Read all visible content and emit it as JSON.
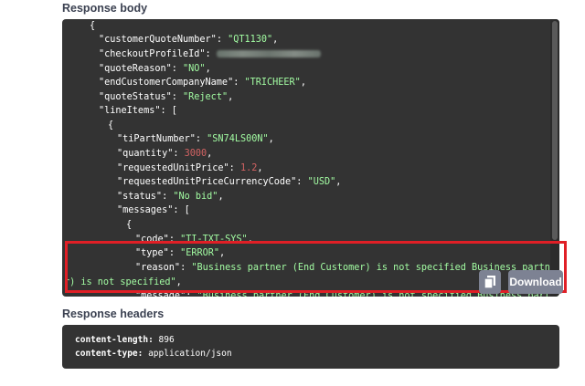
{
  "response_body": {
    "title": "Response body",
    "lines": [
      {
        "t": [
          [
            "p",
            "{"
          ]
        ]
      },
      {
        "t": [
          [
            "k",
            "\"customerQuoteNumber\""
          ],
          [
            "p",
            ": "
          ],
          [
            "s",
            "\"QT1130\""
          ],
          [
            "p",
            ","
          ]
        ]
      },
      {
        "t": [
          [
            "k",
            "\"checkoutProfileId\""
          ],
          [
            "p",
            ": "
          ],
          [
            "blur",
            ""
          ]
        ]
      },
      {
        "t": [
          [
            "k",
            "\"quoteReason\""
          ],
          [
            "p",
            ": "
          ],
          [
            "s",
            "\"NO\""
          ],
          [
            "p",
            ","
          ]
        ]
      },
      {
        "t": [
          [
            "k",
            "\"endCustomerCompanyName\""
          ],
          [
            "p",
            ": "
          ],
          [
            "s",
            "\"TRICHEER\""
          ],
          [
            "p",
            ","
          ]
        ]
      },
      {
        "t": [
          [
            "k",
            "\"quoteStatus\""
          ],
          [
            "p",
            ": "
          ],
          [
            "s",
            "\"Reject\""
          ],
          [
            "p",
            ","
          ]
        ]
      },
      {
        "t": [
          [
            "k",
            "\"lineItems\""
          ],
          [
            "p",
            ": ["
          ]
        ]
      },
      {
        "t": [
          [
            "p",
            "{"
          ]
        ]
      },
      {
        "t": [
          [
            "k",
            "\"tiPartNumber\""
          ],
          [
            "p",
            ": "
          ],
          [
            "s",
            "\"SN74LS00N\""
          ],
          [
            "p",
            ","
          ]
        ]
      },
      {
        "t": [
          [
            "k",
            "\"quantity\""
          ],
          [
            "p",
            ": "
          ],
          [
            "n",
            "3000"
          ],
          [
            "p",
            ","
          ]
        ]
      },
      {
        "t": [
          [
            "k",
            "\"requestedUnitPrice\""
          ],
          [
            "p",
            ": "
          ],
          [
            "n",
            "1.2"
          ],
          [
            "p",
            ","
          ]
        ]
      },
      {
        "t": [
          [
            "k",
            "\"requestedUnitPriceCurrencyCode\""
          ],
          [
            "p",
            ": "
          ],
          [
            "s",
            "\"USD\""
          ],
          [
            "p",
            ","
          ]
        ]
      },
      {
        "t": [
          [
            "k",
            "\"status\""
          ],
          [
            "p",
            ": "
          ],
          [
            "s",
            "\"No bid\""
          ],
          [
            "p",
            ","
          ]
        ]
      },
      {
        "t": [
          [
            "k",
            "\"messages\""
          ],
          [
            "p",
            ": ["
          ]
        ]
      },
      {
        "t": [
          [
            "p",
            "{"
          ]
        ]
      },
      {
        "t": [
          [
            "k",
            "\"code\""
          ],
          [
            "p",
            ": "
          ],
          [
            "s",
            "\"TI-TXT-SYS\""
          ],
          [
            "p",
            ","
          ]
        ]
      },
      {
        "t": [
          [
            "k",
            "\"type\""
          ],
          [
            "p",
            ": "
          ],
          [
            "s",
            "\"ERROR\""
          ],
          [
            "p",
            ","
          ]
        ]
      },
      {
        "t": [
          [
            "k",
            "\"reason\""
          ],
          [
            "p",
            ": "
          ],
          [
            "s",
            "\"Business partner (End Customer) is not specified Business partner (End Custome"
          ]
        ]
      },
      {
        "t": [
          [
            "s",
            "r) is not specified\""
          ],
          [
            "p",
            ","
          ]
        ]
      },
      {
        "t": [
          [
            "k",
            "\"message\""
          ],
          [
            "p",
            ": "
          ],
          [
            "s",
            "\"Business partner (End Customer) is not specified Business partner (End"
          ]
        ]
      }
    ],
    "copy_icon": "copy-icon",
    "download_label": "Download"
  },
  "response_headers": {
    "title": "Response headers",
    "items": [
      {
        "name": "content-length:",
        "value": " 896"
      },
      {
        "name": "content-type:",
        "value": " application/json"
      }
    ]
  },
  "colors": {
    "panel_bg": "#333333",
    "string": "#a2fca2",
    "number": "#d36363",
    "highlight": "#e01f26",
    "button_bg": "#7d8293"
  }
}
